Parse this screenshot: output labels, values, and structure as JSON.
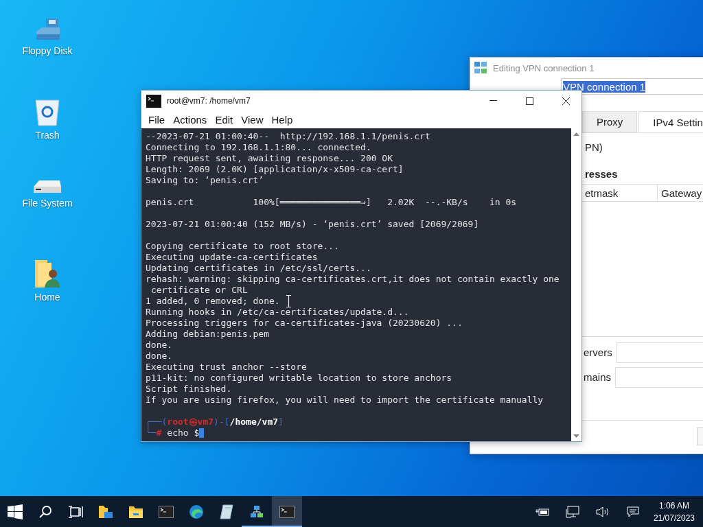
{
  "desktop_icons": [
    {
      "kind": "floppy",
      "label": "Floppy Disk"
    },
    {
      "kind": "trash",
      "label": "Trash"
    },
    {
      "kind": "drive",
      "label": "File System"
    },
    {
      "kind": "home",
      "label": "Home"
    }
  ],
  "vpn_window": {
    "title": "Editing VPN connection 1",
    "connection_name": {
      "value": "VPN connection 1",
      "text_selected": true
    },
    "tabs": [
      {
        "label": "Proxy",
        "selected": false
      },
      {
        "label": "IPv4 Settin",
        "selected": true
      }
    ],
    "method_value": "PN)",
    "section_heading": "resses",
    "table": {
      "columns": [
        "etmask",
        "Gateway"
      ]
    },
    "fields": [
      {
        "label": "ervers"
      },
      {
        "label": "mains"
      }
    ]
  },
  "terminal": {
    "title": "root@vm7: /home/vm7",
    "menu": [
      "File",
      "Actions",
      "Edit",
      "View",
      "Help"
    ],
    "lines": [
      {
        "kind": "output",
        "text": "--2023-07-21 01:00:40--  http://192.168.1.1/penis.crt"
      },
      {
        "kind": "output",
        "text": "Connecting to 192.168.1.1:80... connected."
      },
      {
        "kind": "output",
        "text": "HTTP request sent, awaiting response... 200 OK"
      },
      {
        "kind": "output",
        "text": "Length: 2069 (2.0K) [application/x-x509-ca-cert]"
      },
      {
        "kind": "output",
        "text": "Saving to: ‘penis.crt’"
      },
      {
        "kind": "blank"
      },
      {
        "kind": "output",
        "text": "penis.crt           100%[═══════════════⇒]   2.02K  --.-KB/s    in 0s"
      },
      {
        "kind": "blank"
      },
      {
        "kind": "output",
        "text": "2023-07-21 01:00:40 (152 MB/s) - ‘penis.crt’ saved [2069/2069]"
      },
      {
        "kind": "blank"
      },
      {
        "kind": "output",
        "text": "Copying certificate to root store..."
      },
      {
        "kind": "output",
        "text": "Executing update-ca-certificates"
      },
      {
        "kind": "output",
        "text": "Updating certificates in /etc/ssl/certs..."
      },
      {
        "kind": "output",
        "text": "rehash: warning: skipping ca-certificates.crt,it does not contain exactly one"
      },
      {
        "kind": "output",
        "text": " certificate or CRL"
      },
      {
        "kind": "output",
        "text": "1 added, 0 removed; done."
      },
      {
        "kind": "output",
        "text": "Running hooks in /etc/ca-certificates/update.d..."
      },
      {
        "kind": "output",
        "text": "Processing triggers for ca-certificates-java (20230620) ..."
      },
      {
        "kind": "output",
        "text": "Adding debian:penis.pem"
      },
      {
        "kind": "output",
        "text": "done."
      },
      {
        "kind": "output",
        "text": "done."
      },
      {
        "kind": "output",
        "text": "Executing trust anchor --store"
      },
      {
        "kind": "output",
        "text": "p11-kit: no configured writable location to store anchors"
      },
      {
        "kind": "output",
        "text": "Script finished."
      },
      {
        "kind": "output",
        "text": "If you are using firefox, you will need to import the certificate manually"
      },
      {
        "kind": "blank"
      },
      {
        "kind": "prompt",
        "segments": [
          {
            "kind": "frame",
            "text": "┌──("
          },
          {
            "kind": "user",
            "text": "root㉿vm7"
          },
          {
            "kind": "frame",
            "text": ")-["
          },
          {
            "kind": "path",
            "text": "/home/vm7"
          },
          {
            "kind": "frame",
            "text": "]"
          }
        ]
      },
      {
        "kind": "command",
        "segments": [
          {
            "kind": "frame",
            "text": "└─"
          },
          {
            "kind": "user",
            "text": "#"
          },
          {
            "kind": "plain",
            "text": " echo $"
          }
        ]
      }
    ]
  },
  "taskbar": {
    "apps": [
      {
        "kind": "start",
        "running": false,
        "selected": false
      },
      {
        "kind": "search",
        "running": false,
        "selected": false
      },
      {
        "kind": "taskview",
        "running": false,
        "selected": false
      },
      {
        "kind": "files",
        "running": false,
        "selected": false
      },
      {
        "kind": "folder",
        "running": false,
        "selected": false
      },
      {
        "kind": "terminal",
        "running": false,
        "selected": false
      },
      {
        "kind": "browser",
        "running": false,
        "selected": false
      },
      {
        "kind": "editor",
        "running": false,
        "selected": false
      },
      {
        "kind": "network",
        "running": true,
        "selected": false
      },
      {
        "kind": "terminal",
        "running": true,
        "selected": true
      }
    ],
    "time": "1:06 AM",
    "date": "21/07/2023"
  }
}
